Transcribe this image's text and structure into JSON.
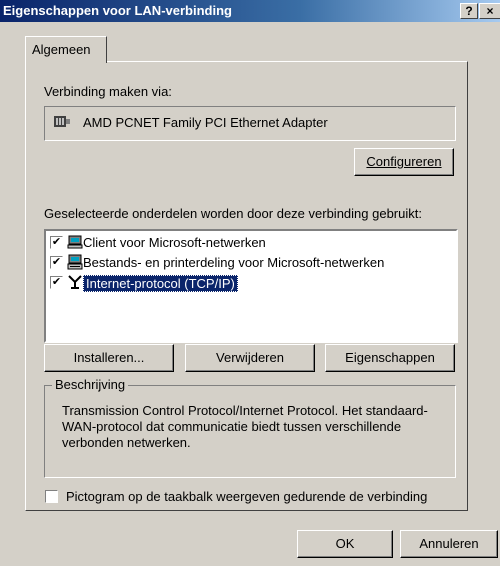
{
  "window": {
    "title": "Eigenschappen voor LAN-verbinding",
    "help_label": "?",
    "close_label": "×"
  },
  "tabs": [
    {
      "label": "Algemeen"
    }
  ],
  "connection": {
    "label": "Verbinding maken via:",
    "adapter": "AMD PCNET Family PCI Ethernet Adapter",
    "configure_label": "Configureren"
  },
  "components": {
    "label": "Geselecteerde onderdelen worden door deze verbinding gebruikt:",
    "items": [
      {
        "label": "Client voor Microsoft-netwerken",
        "checked": true,
        "icon": "network-client-icon"
      },
      {
        "label": "Bestands- en printerdeling voor Microsoft-netwerken",
        "checked": true,
        "icon": "file-printer-sharing-icon"
      },
      {
        "label": "Internet-protocol (TCP/IP)",
        "checked": true,
        "icon": "protocol-icon",
        "selected": true
      }
    ]
  },
  "buttons": {
    "install": "Installeren...",
    "remove": "Verwijderen",
    "properties": "Eigenschappen",
    "ok": "OK",
    "cancel": "Annuleren"
  },
  "description": {
    "title": "Beschrijving",
    "text": "Transmission Control Protocol/Internet Protocol. Het standaard-WAN-protocol dat communicatie biedt tussen verschillende verbonden netwerken."
  },
  "tray_icon": {
    "label": "Pictogram op de taakbalk weergeven gedurende de verbinding",
    "checked": false
  },
  "colors": {
    "titlebar_start": "#0a246a",
    "titlebar_end": "#a6caf0",
    "face": "#d4d0c8",
    "selection": "#0a246a"
  }
}
